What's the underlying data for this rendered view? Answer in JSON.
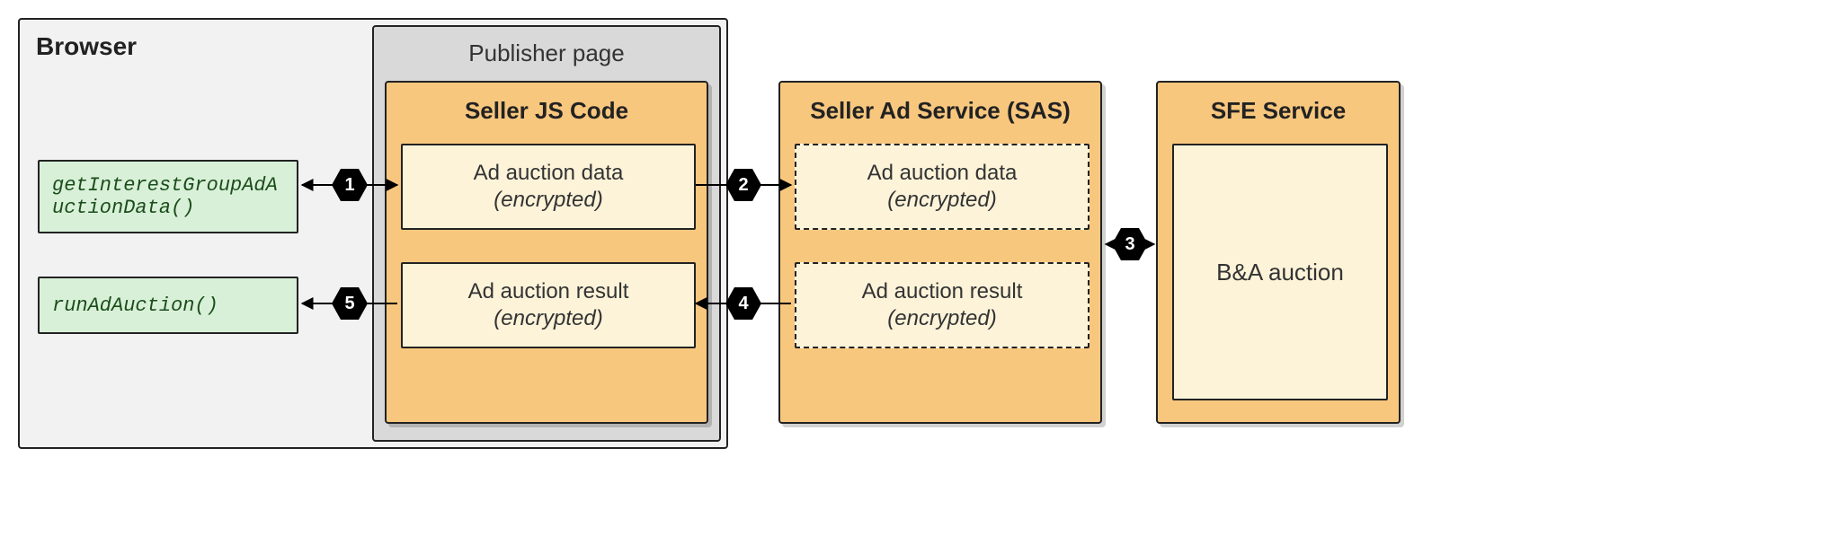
{
  "browser": {
    "label": "Browser"
  },
  "publisher": {
    "label": "Publisher page"
  },
  "api": {
    "getIGData": "getInterestGroupAdAuctionData()",
    "runAdAuction": "runAdAuction()"
  },
  "seller_js": {
    "title": "Seller JS Code",
    "data_box": {
      "line1": "Ad auction data",
      "line2": "(encrypted)"
    },
    "result_box": {
      "line1": "Ad auction result",
      "line2": "(encrypted)"
    }
  },
  "sas": {
    "title": "Seller Ad Service (SAS)",
    "data_box": {
      "line1": "Ad auction data",
      "line2": "(encrypted)"
    },
    "result_box": {
      "line1": "Ad auction result",
      "line2": "(encrypted)"
    }
  },
  "sfe": {
    "title": "SFE Service",
    "auction_label": "B&A auction"
  },
  "steps": {
    "s1": "1",
    "s2": "2",
    "s3": "3",
    "s4": "4",
    "s5": "5"
  }
}
